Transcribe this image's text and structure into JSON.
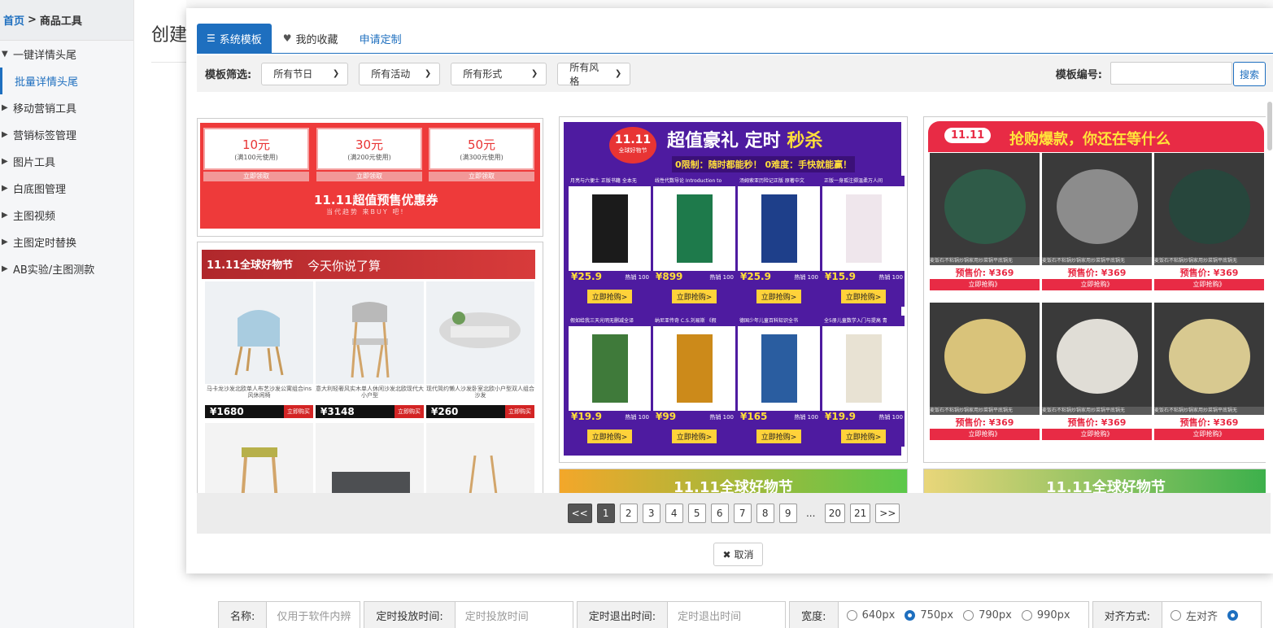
{
  "sidebar": {
    "breadcrumb_home": "首页",
    "breadcrumb_sep": ">",
    "breadcrumb_current": "商品工具",
    "items": [
      {
        "label": "一键详情头尾",
        "arrow": "▼"
      },
      {
        "label": "批量详情头尾",
        "arrow": ""
      },
      {
        "label": "移动营销工具",
        "arrow": "▶"
      },
      {
        "label": "营销标签管理",
        "arrow": "▶"
      },
      {
        "label": "图片工具",
        "arrow": "▶"
      },
      {
        "label": "白底图管理",
        "arrow": "▶"
      },
      {
        "label": "主图视频",
        "arrow": "▶"
      },
      {
        "label": "主图定时替换",
        "arrow": "▶"
      },
      {
        "label": "AB实验/主图测款",
        "arrow": "▶"
      }
    ]
  },
  "page": {
    "title": "创建"
  },
  "modal": {
    "tabs": {
      "system": "系统模板",
      "favorites": "我的收藏",
      "custom": "申请定制"
    },
    "filter": {
      "label": "模板筛选:",
      "festival": "所有节日",
      "activity": "所有活动",
      "form": "所有形式",
      "style": "所有风格",
      "tpl_no_label": "模板编号:",
      "search": "搜索"
    },
    "pager": {
      "prev": "<<",
      "pages": [
        "1",
        "2",
        "3",
        "4",
        "5",
        "6",
        "7",
        "8",
        "9"
      ],
      "ellipsis": "...",
      "p20": "20",
      "p21": "21",
      "next": ">>"
    },
    "cancel": "取消"
  },
  "templates": {
    "coupon": {
      "c1_amt": "10元",
      "c1_cond": "(满100元使用)",
      "c2_amt": "30元",
      "c2_cond": "(满200元使用)",
      "c3_amt": "50元",
      "c3_cond": "(满300元使用)",
      "btn": "立即领取",
      "big": "11.11超值预售优惠券",
      "small": "当代趋势 来BUY 吧!"
    },
    "furniture": {
      "brand": "11.11全球好物节",
      "slogan": "今天你说了算",
      "buy": "立即购买",
      "tag": "预售价",
      "items": [
        {
          "cap": "马卡龙沙发北欧单人布艺沙发公寓组合ins风休闲椅",
          "price": "¥1680"
        },
        {
          "cap": "意大利轻奢风实木单人休闲沙发北欧现代大小户型",
          "price": "¥3148"
        },
        {
          "cap": "现代简约懒人沙发卧室北欧小户型双人组合沙发",
          "price": "¥260"
        }
      ]
    },
    "books": {
      "logo": "11.11",
      "logo_sub": "全球好物节",
      "title_a": "超值豪礼 定时",
      "title_b": "秒杀",
      "sub": "0限制：随时都能秒！ 0难度：手快就能赢！",
      "hot": "热销 100",
      "buy": "立即抢购>",
      "items": [
        {
          "name": "月亮与六便士 正版书籍 全本无",
          "price": "¥25.9"
        },
        {
          "name": "线性代数导论 Introduction to",
          "price": "¥899"
        },
        {
          "name": "汤姆索亚历险记正版 原著中文",
          "price": "¥25.9"
        },
        {
          "name": "正版一身孤注掷温柔万人间",
          "price": "¥15.9"
        },
        {
          "name": "假如给我三天光明无删减全译",
          "price": "¥19.9"
        },
        {
          "name": "纳尼亚传奇 C.S.刘易斯 《假",
          "price": "¥99"
        },
        {
          "name": "德国少年儿童百科知识全书",
          "price": "¥165"
        },
        {
          "name": "全5册儿童数学入门与提高 青",
          "price": "¥19.9"
        }
      ]
    },
    "pans": {
      "logo": "11.11",
      "slogan": "抢购爆款，你还在等什么",
      "price": "预售价: ¥369",
      "buy": "立即抢购》",
      "cap": "麦饭石不粘锅炒锅家用炒菜锅平底锅无"
    },
    "bottom_left": "11.11全球好物节",
    "bottom_right": "11.11全球好物节"
  },
  "form": {
    "name_label": "名称:",
    "name_placeholder": "仅用于软件内辨",
    "start_label": "定时投放时间:",
    "start_placeholder": "定时投放时间",
    "end_label": "定时退出时间:",
    "end_placeholder": "定时退出时间",
    "width_label": "宽度:",
    "widths": [
      "640px",
      "750px",
      "790px",
      "990px"
    ],
    "width_selected": "750px",
    "align_label": "对齐方式:",
    "align_left": "左对齐"
  }
}
